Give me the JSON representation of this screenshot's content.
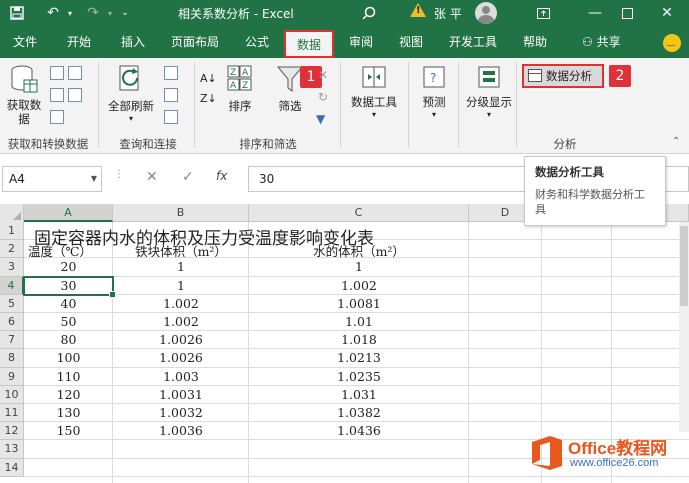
{
  "titlebar": {
    "title": "相关系数分析  -  Excel",
    "user": "张 平"
  },
  "tabs": [
    {
      "label": "文件",
      "active": false
    },
    {
      "label": "开始",
      "active": false
    },
    {
      "label": "插入",
      "active": false
    },
    {
      "label": "页面布局",
      "active": false
    },
    {
      "label": "公式",
      "active": false
    },
    {
      "label": "数据",
      "active": true
    },
    {
      "label": "审阅",
      "active": false
    },
    {
      "label": "视图",
      "active": false
    },
    {
      "label": "开发工具",
      "active": false
    },
    {
      "label": "帮助",
      "active": false
    }
  ],
  "share_label": "共享",
  "ribbon": {
    "get_data": "获取数据",
    "refresh_all": "全部刷新",
    "sort": "排序",
    "filter": "筛选",
    "data_tools": "数据工具",
    "forecast": "预测",
    "outline": "分级显示",
    "data_analysis": "数据分析",
    "groups": {
      "get_transform": "获取和转换数据",
      "queries": "查询和连接",
      "sort_filter": "排序和筛选",
      "analysis": "分析"
    },
    "badge1": "1",
    "badge2": "2"
  },
  "tooltip": {
    "title": "数据分析工具",
    "desc": "财务和科学数据分析工具"
  },
  "formula_bar": {
    "name_box": "A4",
    "value": "30"
  },
  "sheet": {
    "columns": [
      "A",
      "B",
      "C",
      "D"
    ],
    "rows": [
      "1",
      "2",
      "3",
      "4",
      "5",
      "6",
      "7",
      "8",
      "9",
      "10",
      "11",
      "12",
      "13",
      "14"
    ],
    "title": "固定容器内水的体积及压力受温度影响变化表",
    "headers": [
      "温度（℃）",
      "铁块体积（m²）",
      "水的体积（m²）"
    ],
    "data": [
      [
        "20",
        "1",
        "1"
      ],
      [
        "30",
        "1",
        "1.002"
      ],
      [
        "40",
        "1.002",
        "1.0081"
      ],
      [
        "50",
        "1.002",
        "1.01"
      ],
      [
        "80",
        "1.0026",
        "1.018"
      ],
      [
        "100",
        "1.0026",
        "1.0213"
      ],
      [
        "110",
        "1.003",
        "1.0235"
      ],
      [
        "120",
        "1.0031",
        "1.031"
      ],
      [
        "130",
        "1.0032",
        "1.0382"
      ],
      [
        "150",
        "1.0036",
        "1.0436"
      ]
    ]
  },
  "watermark": {
    "text1": "Office教程网",
    "text2": "www.office26.com"
  },
  "colors": {
    "excel_green": "#217346",
    "highlight_red": "#e03030"
  }
}
